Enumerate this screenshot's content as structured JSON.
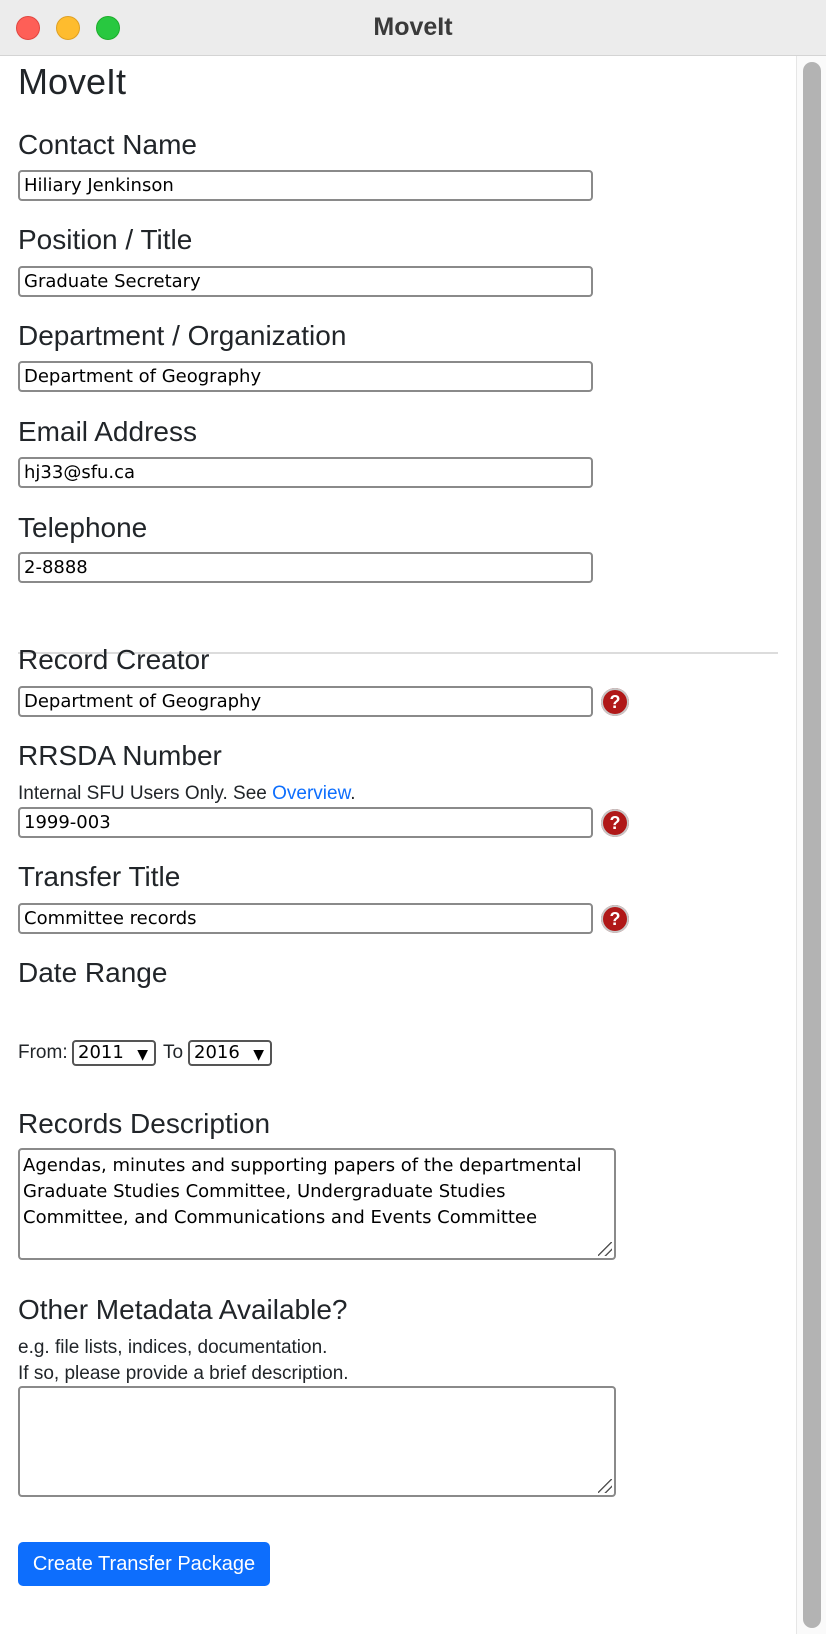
{
  "window": {
    "title": "MoveIt"
  },
  "app": {
    "heading": "MoveIt"
  },
  "contact": {
    "name_label": "Contact Name",
    "name_value": "Hiliary Jenkinson",
    "position_label": "Position / Title",
    "position_value": "Graduate Secretary",
    "department_label": "Department / Organization",
    "department_value": "Department of Geography",
    "email_label": "Email Address",
    "email_value": "hj33@sfu.ca",
    "telephone_label": "Telephone",
    "telephone_value": "2-8888"
  },
  "records": {
    "creator_label": "Record Creator",
    "creator_value": "Department of Geography",
    "rrsda_label": "RRSDA Number",
    "rrsda_help_prefix": "Internal SFU Users Only. See ",
    "rrsda_help_link": "Overview",
    "rrsda_help_suffix": ".",
    "rrsda_value": "1999-003",
    "transfer_title_label": "Transfer Title",
    "transfer_title_value": "Committee records",
    "date_range_label": "Date Range",
    "from_label": "From:",
    "from_value": "2011",
    "to_label": "To",
    "to_value": "2016",
    "description_label": "Records Description",
    "description_value": "Agendas, minutes and supporting papers of the departmental Graduate Studies Committee, Undergraduate Studies Committee, and Communications and Events Committee",
    "metadata_label": "Other Metadata Available?",
    "metadata_help_1": "e.g. file lists, indices, documentation.",
    "metadata_help_2": "If so, please provide a brief description.",
    "metadata_value": ""
  },
  "help_icon": {
    "glyph": "?",
    "name": "question-mark-icon",
    "color": "#b01818"
  },
  "actions": {
    "create_label": "Create Transfer Package",
    "accent": "#0d6efd"
  }
}
